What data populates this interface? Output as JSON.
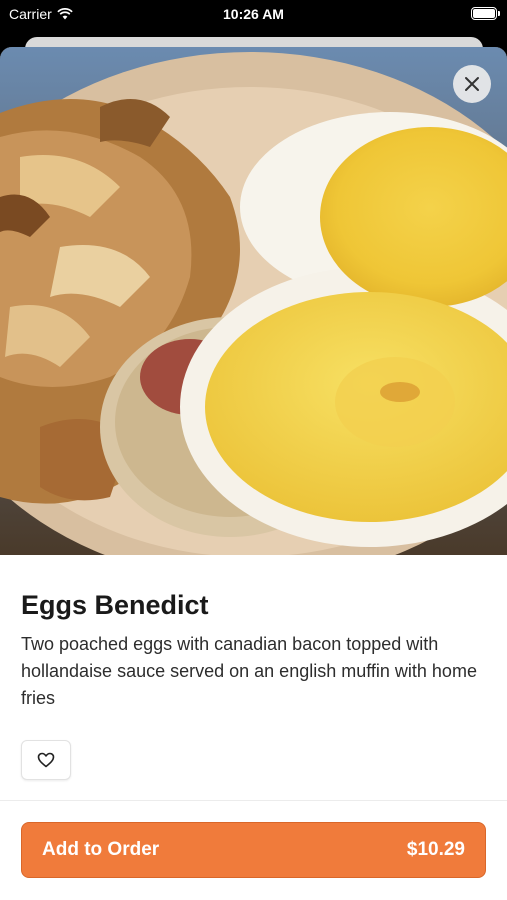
{
  "status_bar": {
    "carrier": "Carrier",
    "time": "10:26 AM"
  },
  "item": {
    "title": "Eggs Benedict",
    "description": "Two poached eggs with canadian bacon topped with hollandaise sauce served on an english muffin with home fries",
    "image_alt": "Eggs Benedict with home fries"
  },
  "actions": {
    "add_label": "Add to Order",
    "price": "$10.29"
  },
  "icons": {
    "close": "close-icon",
    "favorite": "heart-icon",
    "wifi": "wifi-icon",
    "battery": "battery-icon"
  },
  "colors": {
    "accent": "#f07b3b",
    "background": "#ffffff"
  }
}
